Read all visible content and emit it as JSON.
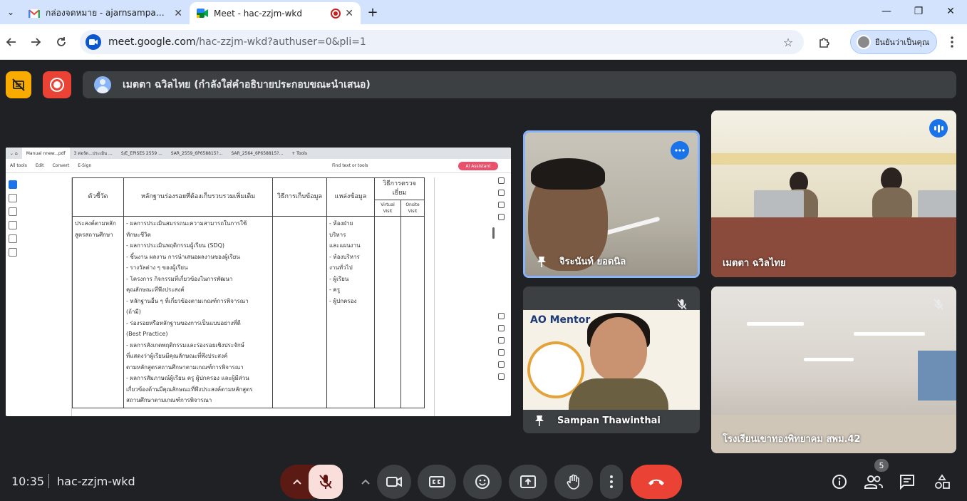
{
  "browser": {
    "tabs": [
      {
        "title": "กล่องจดหมาย - ajarnsampan@gm",
        "icon": "gmail-icon",
        "close": "✕"
      },
      {
        "title": "Meet - hac-zzjm-wkd",
        "icon": "meet-icon",
        "close": "✕",
        "recording": true
      }
    ],
    "new_tab": "+",
    "url_host": "meet.google.com",
    "url_path": "/hac-zzjm-wkd?authuser=0&pli=1",
    "profile_label": "ยืนยันว่าเป็นคุณ",
    "window_controls": {
      "minimize": "—",
      "restore": "❐",
      "close": "✕"
    }
  },
  "meet": {
    "presenter_caption": "เมตตา ฉวิลไทย (กำลังใส่คำอธิบายประกอบขณะนำเสนอ)",
    "meeting_code": "hac-zzjm-wkd",
    "time": "10:35",
    "people_count": "5",
    "accent": "#8ab4f8",
    "end_call_color": "#ea4335"
  },
  "shared_screen": {
    "browser_tabs": [
      "Manual nnew...pdf",
      "3 ต่อวัด...ประเมิน ...",
      "S/E_EPISES 2559 ...",
      "SAR_2559_6P658815?...",
      "SAR_2564_6P658815?...",
      "+ Tools"
    ],
    "menu": [
      "All tools",
      "Edit",
      "Convert",
      "E-Sign"
    ],
    "find_label": "Find text or tools",
    "ai_button": "AI Assistant",
    "table": {
      "headers": {
        "indicator": "ตัวชี้วัด",
        "evidence": "หลักฐานร่องรอยที่ต้องเก็บรวบรวมเพิ่มเติม",
        "method": "วิธีการเก็บข้อมูล",
        "source": "แหล่งข้อมูล",
        "visit": "วิธีการตรวจเยี่ยม",
        "virtual": "Virtual Visit",
        "onsite": "Onsite Visit"
      },
      "row": {
        "indicator": [
          "ประสงค์ตามหลัก",
          "สูตรสถานศึกษา"
        ],
        "evidence": [
          "- ผลการประเมินสมรรถนะความสามารถในการใช้",
          "ทักษะชีวิต",
          "- ผลการประเมินพฤติกรรมผู้เรียน (SDQ)",
          "- ชิ้นงาน ผลงาน การนำเสนอผลงานของผู้เรียน",
          "- รางวัลต่าง ๆ ของผู้เรียน",
          "- โครงการ กิจกรรมที่เกี่ยวข้องในการพัฒนา",
          "คุณลักษณะที่พึงประสงค์",
          "- หลักฐานอื่น ๆ ที่เกี่ยวข้องตามเกณฑ์การพิจารณา",
          "(ถ้ามี)",
          "- ร่องรอยหรือหลักฐานของการเป็นแบบอย่างที่ดี",
          "(Best Practice)",
          "- ผลการสังเกตพฤติกรรมและร่องรอยเชิงประจักษ์",
          "ที่แสดงว่าผู้เรียนมีคุณลักษณะที่พึงประสงค์",
          "ตามหลักสูตรสถานศึกษาตามเกณฑ์การพิจารณา",
          "- ผลการสัมภาษณ์ผู้เรียน ครู ผู้ปกครอง และผู้มีส่วน",
          "เกี่ยวข้องด้านมีคุณลักษณะที่พึงประสงค์ตามหลักสูตร",
          "สถานศึกษาตามเกณฑ์การพิจารณา"
        ],
        "source": [
          "- ห้องฝ่าย",
          "บริหาร",
          "และแผนงาน",
          "- ห้องบริหาร",
          "งานทั่วไป",
          "- ผู้เรียน",
          "- ครู",
          "- ผู้ปกครอง"
        ]
      }
    }
  },
  "participants": [
    {
      "name": "จิระนันท์ ยอดนิล",
      "pinned": true,
      "badge": "more"
    },
    {
      "name": "เมตตา ฉวิลไทย",
      "pinned": false,
      "badge": "speaking"
    },
    {
      "name": "Sampan Thawinthai",
      "pinned": true,
      "badge": "muted",
      "banner": "AO Mentor"
    },
    {
      "name": "โรงเรียนเขาทองพิทยาคม สพม.42",
      "pinned": false,
      "badge": "muted"
    }
  ]
}
